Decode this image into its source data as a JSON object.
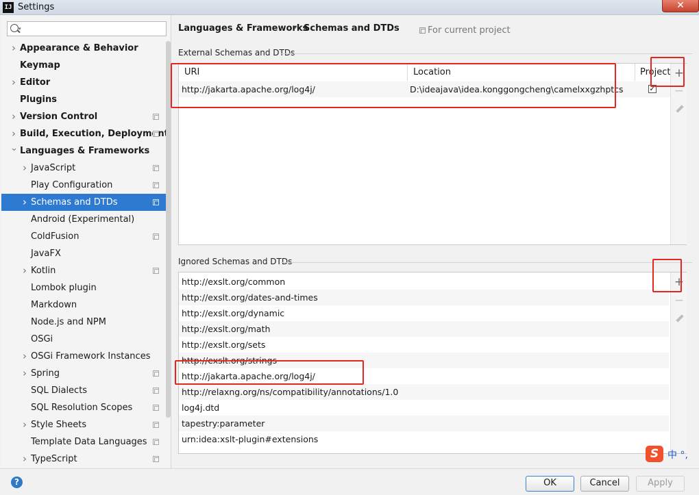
{
  "window": {
    "title": "Settings",
    "app_icon": "intellij-logo-icon"
  },
  "search": {
    "placeholder": "",
    "value": ""
  },
  "sidebar": {
    "items": [
      {
        "label": "Appearance & Behavior",
        "bold": true,
        "arrow": "right"
      },
      {
        "label": "Keymap",
        "bold": true,
        "arrow": ""
      },
      {
        "label": "Editor",
        "bold": true,
        "arrow": "right"
      },
      {
        "label": "Plugins",
        "bold": true,
        "arrow": ""
      },
      {
        "label": "Version Control",
        "bold": true,
        "arrow": "right"
      },
      {
        "label": "Build, Execution, Deployment",
        "bold": true,
        "arrow": "right"
      },
      {
        "label": "Languages & Frameworks",
        "bold": true,
        "arrow": "down"
      },
      {
        "label": "JavaScript",
        "bold": false,
        "arrow": "right"
      },
      {
        "label": "Play Configuration",
        "bold": false,
        "arrow": ""
      },
      {
        "label": "Schemas and DTDs",
        "bold": false,
        "arrow": "right",
        "selected": true
      },
      {
        "label": "Android (Experimental)",
        "bold": false,
        "arrow": ""
      },
      {
        "label": "ColdFusion",
        "bold": false,
        "arrow": ""
      },
      {
        "label": "JavaFX",
        "bold": false,
        "arrow": ""
      },
      {
        "label": "Kotlin",
        "bold": false,
        "arrow": "right"
      },
      {
        "label": "Lombok plugin",
        "bold": false,
        "arrow": ""
      },
      {
        "label": "Markdown",
        "bold": false,
        "arrow": ""
      },
      {
        "label": "Node.js and NPM",
        "bold": false,
        "arrow": ""
      },
      {
        "label": "OSGi",
        "bold": false,
        "arrow": ""
      },
      {
        "label": "OSGi Framework Instances",
        "bold": false,
        "arrow": "right"
      },
      {
        "label": "Spring",
        "bold": false,
        "arrow": "right"
      },
      {
        "label": "SQL Dialects",
        "bold": false,
        "arrow": ""
      },
      {
        "label": "SQL Resolution Scopes",
        "bold": false,
        "arrow": ""
      },
      {
        "label": "Style Sheets",
        "bold": false,
        "arrow": "right"
      },
      {
        "label": "Template Data Languages",
        "bold": false,
        "arrow": ""
      },
      {
        "label": "TypeScript",
        "bold": false,
        "arrow": "right"
      }
    ]
  },
  "breadcrumb": {
    "parent": "Languages & Frameworks",
    "separator": "›",
    "current": "Schemas and DTDs",
    "scope": "For current project"
  },
  "external": {
    "title": "External Schemas and DTDs",
    "columns": [
      "URI",
      "Location",
      "Project"
    ],
    "rows": [
      {
        "uri": "http://jakarta.apache.org/log4j/",
        "location": "D:\\ideajava\\idea.konggongcheng\\camelxxgzhptcs",
        "project": true
      }
    ]
  },
  "ignored": {
    "title": "Ignored Schemas and DTDs",
    "rows": [
      "http://exslt.org/common",
      "http://exslt.org/dates-and-times",
      "http://exslt.org/dynamic",
      "http://exslt.org/math",
      "http://exslt.org/sets",
      "http://exslt.org/strings",
      "http://jakarta.apache.org/log4j/",
      "http://relaxng.org/ns/compatibility/annotations/1.0",
      "log4j.dtd",
      "tapestry:parameter",
      "urn:idea:xslt-plugin#extensions"
    ]
  },
  "toolbar": {
    "add": "+",
    "remove": "−",
    "edit_icon": "pencil-icon"
  },
  "buttons": {
    "ok": "OK",
    "cancel": "Cancel",
    "apply": "Apply",
    "help": "?"
  },
  "ime": {
    "logo": "S",
    "text": "中 °,"
  },
  "colors": {
    "selection": "#2e7ad1",
    "annotation": "#e52520"
  }
}
